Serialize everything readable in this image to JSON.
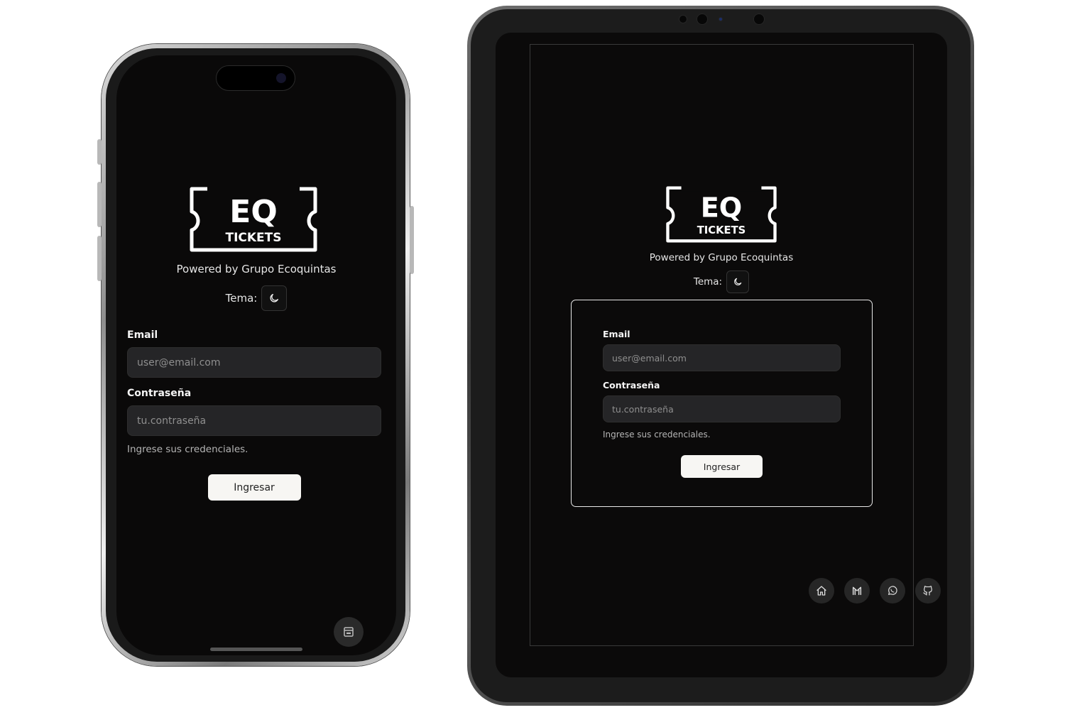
{
  "brand": {
    "logo_main": "EQ",
    "logo_sub": "TICKETS",
    "powered_by": "Powered by Grupo Ecoquintas"
  },
  "theme": {
    "label": "Tema:",
    "icon": "moon-icon"
  },
  "login_form": {
    "email_label": "Email",
    "email_placeholder": "user@email.com",
    "password_label": "Contraseña",
    "password_placeholder": "tu.contraseña",
    "hint": "Ingrese sus credenciales.",
    "submit_label": "Ingresar"
  },
  "phone": {
    "floating_button_icon": "panel-icon"
  },
  "tablet": {
    "social_links": [
      {
        "icon": "home-icon"
      },
      {
        "icon": "gmail-icon"
      },
      {
        "icon": "whatsapp-icon"
      },
      {
        "icon": "github-icon"
      }
    ]
  },
  "colors": {
    "background": "#0a0909",
    "input_background": "#252527",
    "button_background": "#f7f6f3",
    "text": "#f2f2f2"
  }
}
